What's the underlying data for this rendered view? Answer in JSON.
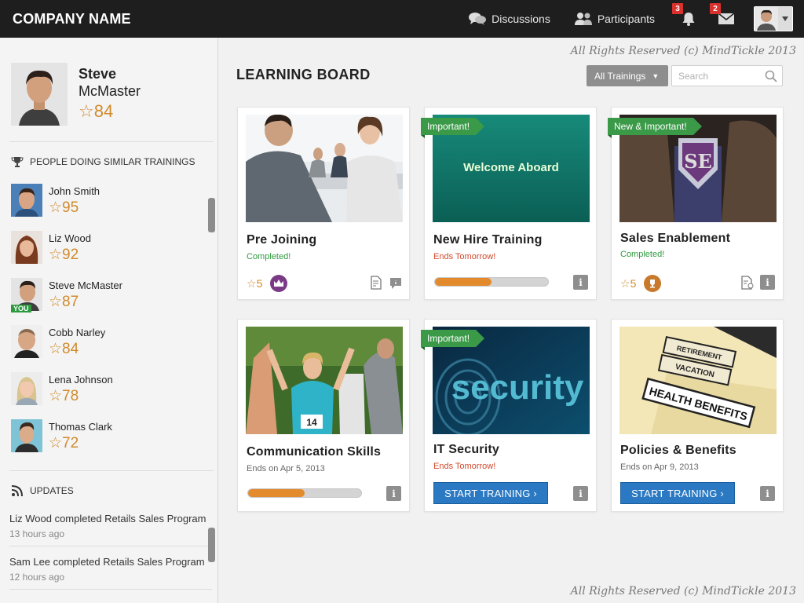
{
  "header": {
    "company": "COMPANY NAME",
    "discussions": "Discussions",
    "participants": "Participants",
    "notifications_count": "3",
    "messages_count": "2"
  },
  "profile": {
    "first_name": "Steve",
    "last_name": "McMaster",
    "points": "84"
  },
  "people_section": {
    "title": "PEOPLE DOING SIMILAR TRAININGS",
    "people": [
      {
        "name": "John Smith",
        "points": "95"
      },
      {
        "name": "Liz Wood",
        "points": "92"
      },
      {
        "name": "Steve McMaster",
        "points": "87",
        "tag": "YOU"
      },
      {
        "name": "Cobb Narley",
        "points": "84"
      },
      {
        "name": "Lena Johnson",
        "points": "78"
      },
      {
        "name": "Thomas Clark",
        "points": "72"
      }
    ]
  },
  "updates_section": {
    "title": "UPDATES",
    "items": [
      {
        "text": "Liz Wood completed Retails Sales Program",
        "time": "13 hours ago"
      },
      {
        "text": "Sam Lee completed Retails Sales Program",
        "time": "12 hours ago"
      }
    ]
  },
  "main": {
    "rights": "All Rights Reserved (c) MindTickle 2013",
    "board_title": "LEARNING BOARD",
    "filter_label": "All Trainings",
    "search_placeholder": "Search",
    "star_glyph": "☆",
    "cards": [
      {
        "title": "Pre Joining",
        "status": "Completed!",
        "stars": "5",
        "image_text": ""
      },
      {
        "title": "New Hire Training",
        "status": "Ends Tomorrow!",
        "ribbon": "Important!",
        "image_text": "Welcome Aboard",
        "progress": 0.5
      },
      {
        "title": "Sales Enablement",
        "status": "Completed!",
        "ribbon": "New & Important!",
        "stars": "5",
        "image_text": "SE"
      },
      {
        "title": "Communication Skills",
        "status": "Ends on Apr 5, 2013",
        "progress": 0.5,
        "image_text": "14"
      },
      {
        "title": "IT Security",
        "status": "Ends Tomorrow!",
        "ribbon": "Important!",
        "image_text": "security",
        "button": "START TRAINING ›"
      },
      {
        "title": "Policies & Benefits",
        "status": "Ends on Apr 9, 2013",
        "image_text_1": "RETIREMENT",
        "image_text_2": "VACATION",
        "image_text_3": "HEALTH BENEFITS",
        "button": "START TRAINING ›"
      }
    ],
    "info_glyph": "i"
  },
  "colors": {
    "topbar": "#1e1e1e",
    "ribbon": "#3a9a48",
    "accent_blue": "#2a79c2",
    "points": "#d08a2c",
    "progress": "#e38a2c"
  }
}
